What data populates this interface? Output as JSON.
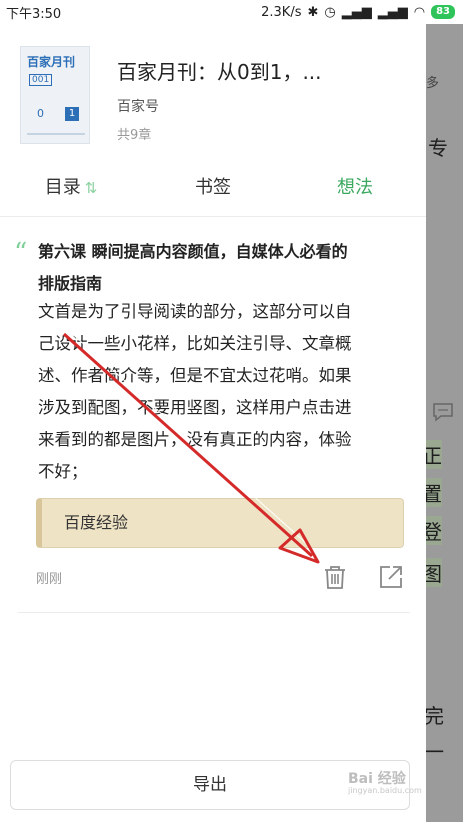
{
  "statusbar": {
    "time": "下午3:50",
    "net_speed": "2.3K/s",
    "battery": "83"
  },
  "background_page": {
    "chars": [
      "多",
      "专",
      "正",
      "置",
      "登",
      "图",
      "完",
      "一"
    ]
  },
  "book": {
    "cover_title": "百家月刊",
    "cover_issue": "001",
    "cover_digit_0": "0",
    "cover_digit_1": "1",
    "title": "百家月刊：从0到1，...",
    "author": "百家号",
    "chapters": "共9章"
  },
  "tabs": [
    {
      "label": "目录",
      "active": false
    },
    {
      "label": "书签",
      "active": false
    },
    {
      "label": "想法",
      "active": true
    }
  ],
  "note": {
    "title_line1": "第六课 瞬间提高内容颜值，自媒体人必看的",
    "title_line2": "排版指南",
    "body_lines": [
      "文首是为了引导阅读的部分，这部分可以自",
      "己设计一些小花样，比如关注引导、文章概",
      "述、作者简介等，但是不宜太过花哨。如果",
      "涉及到配图，不要用竖图，这样用户点击进",
      "来看到的都是图片，没有真正的内容，体验",
      "不好；"
    ],
    "highlight": "百度经验",
    "time": "刚刚"
  },
  "export_label": "导出",
  "watermark": {
    "text": "Bai 经验",
    "sub": "jingyan.baidu.com"
  },
  "colors": {
    "accent_green": "#3aa85f",
    "highlight_bg": "#efe3c5",
    "arrow_red": "#d42a2a"
  }
}
